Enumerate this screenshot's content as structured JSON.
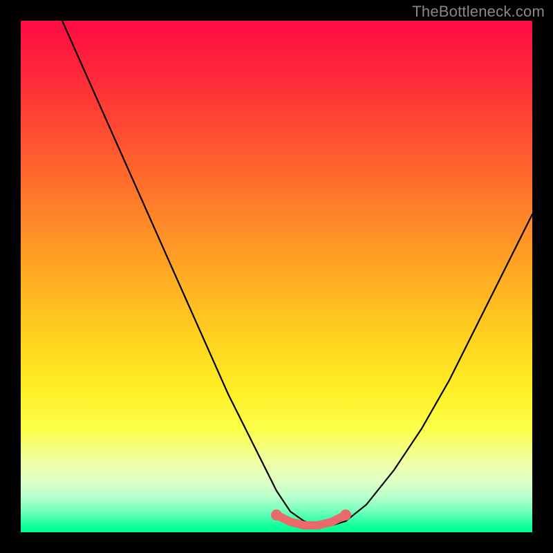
{
  "watermark": {
    "text": "TheBottleneck.com"
  },
  "chart_data": {
    "type": "line",
    "title": "",
    "xlabel": "",
    "ylabel": "",
    "x_range": [
      0,
      740
    ],
    "y_range_plot": [
      0,
      740
    ],
    "series": [
      {
        "name": "bottleneck-curve",
        "x": [
          60,
          100,
          140,
          180,
          220,
          260,
          300,
          340,
          370,
          390,
          410,
          430,
          450,
          470,
          500,
          540,
          580,
          620,
          660,
          700,
          740
        ],
        "y_plot": [
          0,
          90,
          180,
          270,
          360,
          450,
          540,
          620,
          680,
          710,
          724,
          730,
          730,
          724,
          700,
          650,
          590,
          520,
          440,
          360,
          280
        ]
      }
    ],
    "highlight": {
      "name": "optimal-range",
      "x": [
        370,
        390,
        410,
        430,
        450,
        470
      ],
      "y_plot": [
        715,
        725,
        730,
        730,
        725,
        715
      ]
    },
    "background_gradient": [
      {
        "stop": 0.0,
        "color": "#ff0b45"
      },
      {
        "stop": 0.5,
        "color": "#ffa524"
      },
      {
        "stop": 0.8,
        "color": "#fbff4a"
      },
      {
        "stop": 1.0,
        "color": "#00ff91"
      }
    ]
  }
}
